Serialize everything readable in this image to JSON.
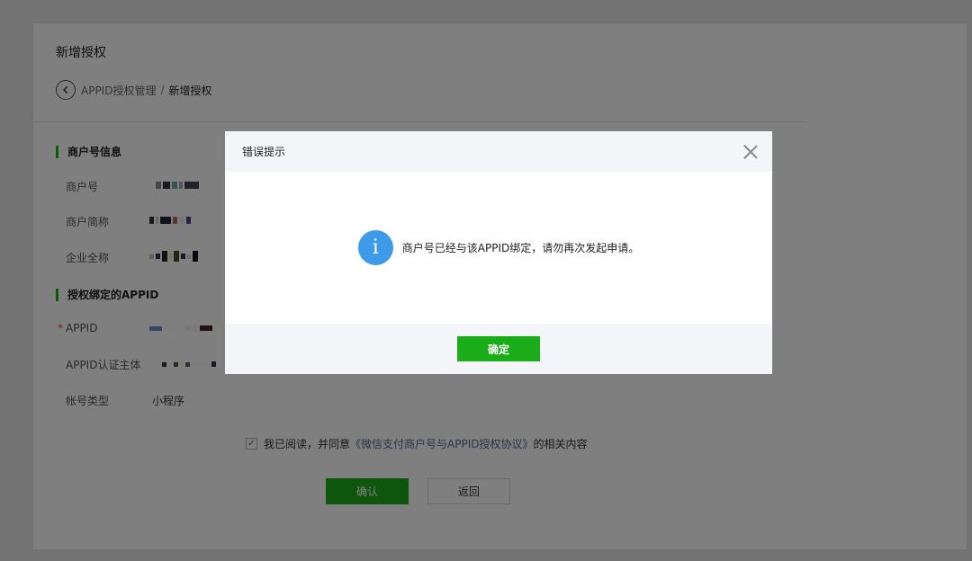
{
  "page": {
    "title": "新增授权",
    "breadcrumb": {
      "link": "APPID授权管理",
      "separator": "/",
      "current": "新增授权"
    }
  },
  "sections": {
    "merchant_info": "商户号信息",
    "appid_bind": "授权绑定的APPID"
  },
  "fields": {
    "merchant_no_label": "商户号",
    "merchant_short_label": "商户简称",
    "company_full_label": "企业全称",
    "appid_required_mark": "*",
    "appid_label": "APPID",
    "appid_subject_label": "APPID认证主体",
    "account_type_label": "帐号类型",
    "account_type_value": "小程序"
  },
  "agreement": {
    "checkbox_mark": "✓",
    "prefix": "我已阅读，并同意",
    "link": "《微信支付商户号与APPID授权协议》",
    "suffix": "的相关内容"
  },
  "actions": {
    "confirm": "确认",
    "back": "返回"
  },
  "dialog": {
    "title": "错误提示",
    "info_glyph": "i",
    "message": "商户号已经与该APPID绑定，请勿再次发起申请。",
    "ok": "确定"
  },
  "colors": {
    "accent_green": "#1aad19",
    "info_blue": "#3e9bea",
    "link_blue": "#576b95",
    "required_red": "#e64340"
  },
  "icons": {
    "back": "chevron-left-circle-icon",
    "close": "close-icon",
    "info": "info-circle-icon",
    "check": "check-icon"
  }
}
